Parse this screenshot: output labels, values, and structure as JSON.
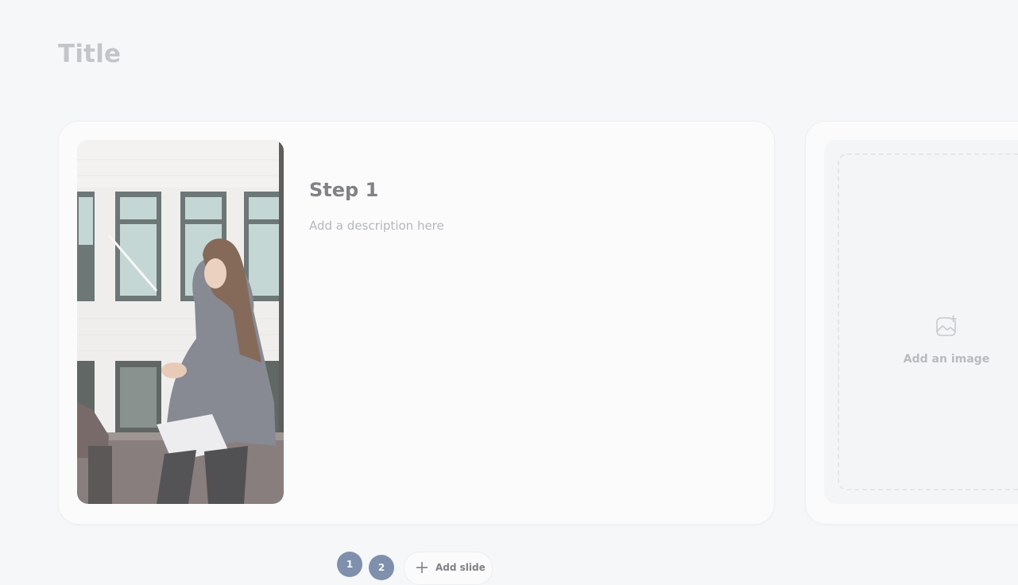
{
  "page": {
    "title": "Title"
  },
  "slides": [
    {
      "step_title": "Step 1",
      "description_placeholder": "Add a description here",
      "image_alt": "Woman smiling sitting by a window holding a laptop"
    },
    {
      "add_image_label": "Add an image"
    }
  ],
  "pagination": {
    "pages": [
      "1",
      "2"
    ],
    "add_slide_label": "Add slide"
  },
  "icons": {
    "add_image": "image-plus-icon",
    "add_slide": "plus-icon"
  },
  "colors": {
    "background": "#f6f7f9",
    "card": "#fbfbfc",
    "page_dot": "#7f90ac"
  }
}
